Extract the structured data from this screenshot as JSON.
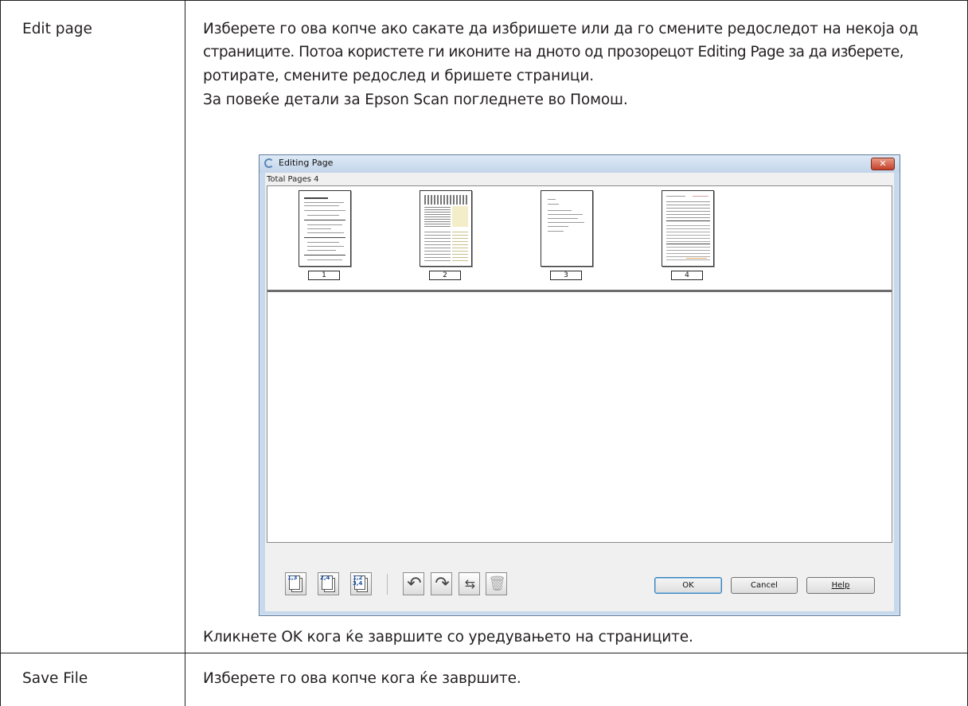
{
  "rows": [
    {
      "label": "Edit page",
      "lines": [
        "Изберете го ова копче ако сакате да избришете или да го смените редоследот на некоја од",
        "страниците. Потоа користете ги иконите на дното од прозорецот Editing Page за да изберете,",
        "ротирате, смените редослед и бришете страници.",
        "За повеќе детали за Epson Scan погледнете во Помош."
      ],
      "note": "Кликнете OK кога ќе завршите со уредувањето на страниците."
    },
    {
      "label": "Save File",
      "text": "Изберете го ова копче кога ќе завршите."
    }
  ],
  "dialog": {
    "title": "Editing Page",
    "close_label": "✕",
    "total_pages_label": "Total Pages 4",
    "pages": [
      "1",
      "2",
      "3",
      "4"
    ],
    "toolbar": [
      {
        "name": "select-odd-pages-icon",
        "badge": "1,3"
      },
      {
        "name": "select-even-pages-icon",
        "badge": "2,4"
      },
      {
        "name": "select-all-pages-icon",
        "badge": "1,2\n3,4"
      },
      {
        "name": "rotate-left-icon"
      },
      {
        "name": "rotate-right-icon"
      },
      {
        "name": "reorder-pages-icon"
      },
      {
        "name": "delete-page-icon"
      }
    ],
    "buttons": {
      "ok": "OK",
      "cancel": "Cancel",
      "help": "Help"
    }
  }
}
